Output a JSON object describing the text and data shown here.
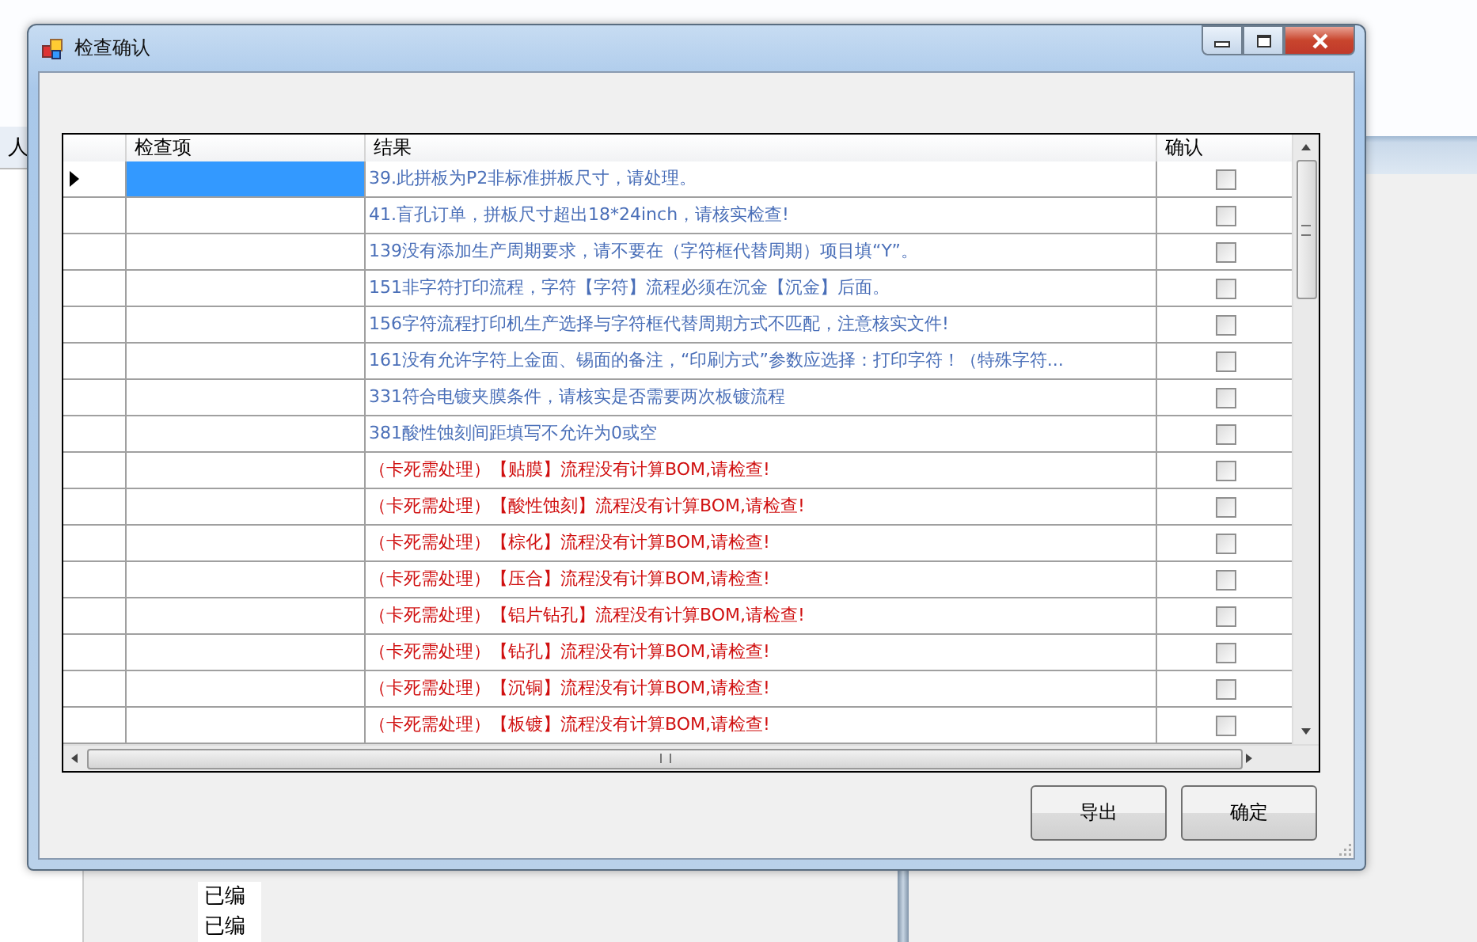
{
  "background": {
    "header": "人",
    "cells": [
      "已编",
      "已编"
    ]
  },
  "window": {
    "title": "检查确认"
  },
  "table": {
    "columns": [
      "检查项",
      "结果",
      "确认"
    ],
    "rows": [
      {
        "item": "",
        "result": "39.此拼板为P2非标准拼板尺寸，请处理。",
        "kind": "info",
        "confirmed": false,
        "selected": true
      },
      {
        "item": "",
        "result": "41.盲孔订单，拼板尺寸超出18*24inch，请核实检查!",
        "kind": "info",
        "confirmed": false,
        "selected": false
      },
      {
        "item": "",
        "result": "139没有添加生产周期要求，请不要在（字符框代替周期）项目填“Y”。",
        "kind": "info",
        "confirmed": false,
        "selected": false
      },
      {
        "item": "",
        "result": "151非字符打印流程，字符【字符】流程必须在沉金【沉金】后面。",
        "kind": "info",
        "confirmed": false,
        "selected": false
      },
      {
        "item": "",
        "result": "156字符流程打印机生产选择与字符框代替周期方式不匹配，注意核实文件!",
        "kind": "info",
        "confirmed": false,
        "selected": false
      },
      {
        "item": "",
        "result": "161没有允许字符上金面、锡面的备注，“印刷方式”参数应选择：打印字符！（特殊字符...",
        "kind": "info",
        "confirmed": false,
        "selected": false
      },
      {
        "item": "",
        "result": "331符合电镀夹膜条件，请核实是否需要两次板镀流程",
        "kind": "info",
        "confirmed": false,
        "selected": false
      },
      {
        "item": "",
        "result": "381酸性蚀刻间距填写不允许为0或空",
        "kind": "info",
        "confirmed": false,
        "selected": false
      },
      {
        "item": "",
        "result": "（卡死需处理）【贴膜】流程没有计算BOM,请检查!",
        "kind": "blocking",
        "confirmed": false,
        "selected": false
      },
      {
        "item": "",
        "result": "（卡死需处理）【酸性蚀刻】流程没有计算BOM,请检查!",
        "kind": "blocking",
        "confirmed": false,
        "selected": false
      },
      {
        "item": "",
        "result": "（卡死需处理）【棕化】流程没有计算BOM,请检查!",
        "kind": "blocking",
        "confirmed": false,
        "selected": false
      },
      {
        "item": "",
        "result": "（卡死需处理）【压合】流程没有计算BOM,请检查!",
        "kind": "blocking",
        "confirmed": false,
        "selected": false
      },
      {
        "item": "",
        "result": "（卡死需处理）【铝片钻孔】流程没有计算BOM,请检查!",
        "kind": "blocking",
        "confirmed": false,
        "selected": false
      },
      {
        "item": "",
        "result": "（卡死需处理）【钻孔】流程没有计算BOM,请检查!",
        "kind": "blocking",
        "confirmed": false,
        "selected": false
      },
      {
        "item": "",
        "result": "（卡死需处理）【沉铜】流程没有计算BOM,请检查!",
        "kind": "blocking",
        "confirmed": false,
        "selected": false
      },
      {
        "item": "",
        "result": "（卡死需处理）【板镀】流程没有计算BOM,请检查!",
        "kind": "blocking",
        "confirmed": false,
        "selected": false
      }
    ]
  },
  "buttons": [
    "导出",
    "确定"
  ]
}
